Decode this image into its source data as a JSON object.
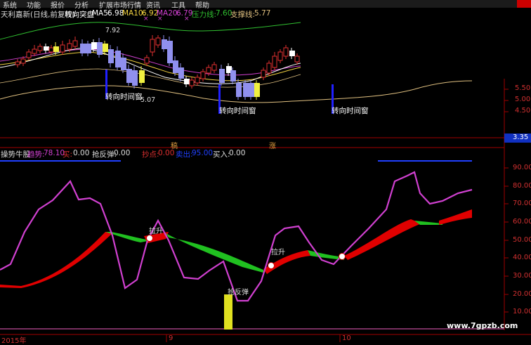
{
  "menu": [
    "系统",
    "功能",
    "报价",
    "分析",
    "扩展市场行情",
    "资讯",
    "工具",
    "帮助"
  ],
  "header": {
    "title": "天利嘉新(日线,前复权)",
    "indicator": "转向突盘",
    "ma5_label": "MA5:",
    "ma5": "6.98",
    "ma10_label": "MA10:",
    "ma10": "6.92",
    "ma20_label": "MA20:",
    "ma20": "6.79",
    "pressure_label": "压力线:",
    "pressure": "7.60",
    "support_label": "支撑线:",
    "support": "5.77"
  },
  "upper_annotations": {
    "high": "7.92",
    "low": "5.07",
    "window_label": "转向时间窗",
    "mark_x": "×"
  },
  "upper_axis": [
    "5.50",
    "5.00",
    "4.50"
  ],
  "price_tag": "3.35",
  "mid_labels": {
    "left": "稿",
    "right": "涨"
  },
  "lower_header": {
    "title": "操势牛股",
    "trend_label": "趋势:",
    "trend": "78.10",
    "buy_label": "买:",
    "buy": "0.00",
    "rebound_label": "抢反弹:",
    "rebound": "0.00",
    "sell_label": "抄点:",
    "sell": "0.00",
    "sellout_label": "卖出:",
    "sellout": "95.00",
    "buyin_label": "买入:",
    "buyin": "0.00"
  },
  "lower_axis": [
    "90.00",
    "80.00",
    "70.00",
    "60.00",
    "50.00",
    "40.00",
    "30.00",
    "20.00",
    "10.00"
  ],
  "lower_annotations": {
    "lift": "拉升",
    "rebound": "抢反弹"
  },
  "dates": [
    "2015年",
    "9",
    "10"
  ],
  "watermark": "www.7gpzb.com",
  "colors": {
    "up": "#e03030",
    "down_blue": "#9090ee",
    "down_yellow": "#f0f040",
    "ma5": "#ffffff",
    "ma10": "#f0d040",
    "ma20": "#d040d0",
    "pressure": "#30c030",
    "support": "#e0c080",
    "trend": "#d040d0",
    "band_up": "#e00000",
    "band_down": "#20c020"
  }
}
